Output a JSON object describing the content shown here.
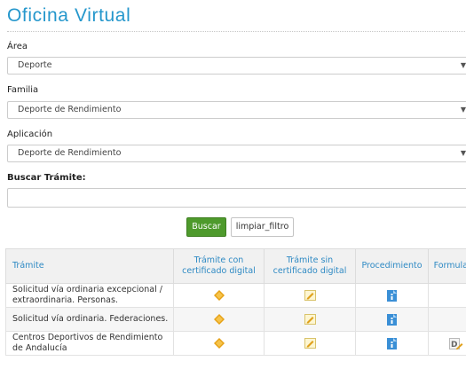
{
  "page": {
    "title": "Oficina Virtual"
  },
  "filters": {
    "area": {
      "label": "Área",
      "value": "Deporte"
    },
    "familia": {
      "label": "Familia",
      "value": "Deporte de Rendimiento"
    },
    "aplicacion": {
      "label": "Aplicación",
      "value": "Deporte de Rendimiento"
    },
    "buscar": {
      "label": "Buscar Trámite:",
      "value": "",
      "placeholder": ""
    }
  },
  "buttons": {
    "search_label": "Buscar",
    "clear_label": "limpiar_filtro"
  },
  "table": {
    "headers": {
      "tramite": "Trámite",
      "con_cert": "Trámite con certificado digital",
      "sin_cert": "Trámite sin certificado digital",
      "procedimiento": "Procedimiento",
      "formulario": "Formulario"
    },
    "rows": [
      {
        "name": "Solicitud vía ordinaria excepcional / extraordinaria. Personas.",
        "con_cert": "cert-envelope-icon",
        "sin_cert": "no-cert-form-icon",
        "procedimiento": "info-document-icon",
        "formulario": ""
      },
      {
        "name": "Solicitud vía ordinaria. Federaciones.",
        "con_cert": "cert-envelope-icon",
        "sin_cert": "no-cert-form-icon",
        "procedimiento": "info-document-icon",
        "formulario": ""
      },
      {
        "name": "Centros Deportivos de Rendimiento de Andalucía",
        "con_cert": "cert-envelope-icon",
        "sin_cert": "no-cert-form-icon",
        "procedimiento": "info-document-icon",
        "formulario": "download-form-icon"
      }
    ]
  },
  "colors": {
    "title": "#2597cc",
    "header_text": "#2f8ac4",
    "search_button": "#4e9a2c"
  }
}
